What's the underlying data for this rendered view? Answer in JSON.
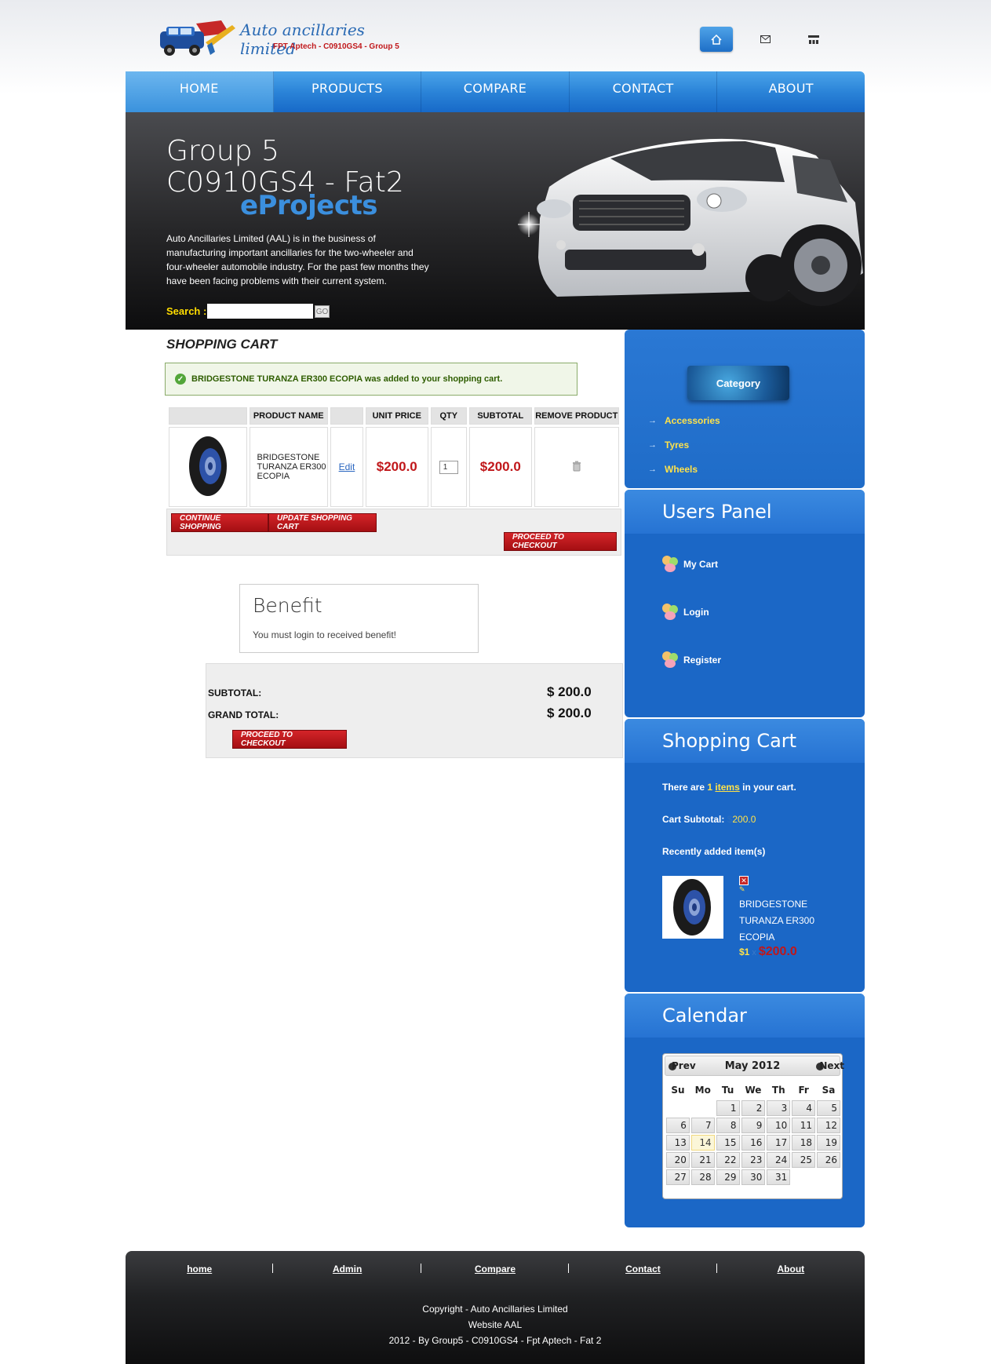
{
  "header": {
    "logo_title": "Auto ancillaries limited",
    "logo_subtitle": "FPT Aptech - C0910GS4 - Group 5",
    "icons": [
      "home-icon",
      "mail-icon",
      "sitemap-icon"
    ]
  },
  "nav": {
    "items": [
      "HOME",
      "PRODUCTS",
      "COMPARE",
      "CONTACT",
      "ABOUT"
    ],
    "active": "HOME"
  },
  "hero": {
    "title_line1": "Group 5",
    "title_line2": "C0910GS4 - Fat2",
    "eprojects": "eProjects",
    "description": "Auto Ancillaries Limited (AAL) is in the business of manufacturing important ancillaries for the two-wheeler and four-wheeler automobile industry. For the past few months they have been facing problems with their current system.",
    "search_label": "Search :",
    "search_value": "",
    "search_button": "GO"
  },
  "cart": {
    "title": "SHOPPING CART",
    "success_message": "BRIDGESTONE TURANZA ER300 ECOPIA was added to your shopping cart.",
    "columns": [
      "",
      "PRODUCT NAME",
      "",
      "UNIT PRICE",
      "QTY",
      "SUBTOTAL",
      "REMOVE PRODUCT"
    ],
    "rows": [
      {
        "name": "BRIDGESTONE TURANZA ER300 ECOPIA",
        "edit": "Edit",
        "unit_price": "$200.0",
        "qty": "1",
        "subtotal": "$200.0"
      }
    ],
    "continue_button": "CONTINUE SHOPPING",
    "update_button": "UPDATE SHOPPING CART",
    "checkout_button": "PROCEED TO CHECKOUT"
  },
  "benefit": {
    "title": "Benefit",
    "text": "You must login to received benefit!"
  },
  "totals": {
    "subtotal_label": "SUBTOTAL:",
    "subtotal_value": "$ 200.0",
    "grand_label": "GRAND TOTAL:",
    "grand_value": "$ 200.0",
    "checkout_button": "PROCEED TO CHECKOUT"
  },
  "sidebar": {
    "category": {
      "button": "Category",
      "items": [
        "Accessories",
        "Tyres",
        "Wheels"
      ]
    },
    "users_panel": {
      "title": "Users Panel",
      "items": [
        "My Cart",
        "Login",
        "Register"
      ]
    },
    "shopping_cart": {
      "title": "Shopping Cart",
      "there_are": "There are",
      "count": "1",
      "items_link": "items",
      "in_your_cart": "in your cart.",
      "subtotal_label": "Cart Subtotal:",
      "subtotal_currency": "$",
      "subtotal_value": "200.0",
      "recent_label": "Recently added item(s)",
      "recent_item_name": "BRIDGESTONE TURANZA ER300 ECOPIA",
      "recent_item_qty": "$1",
      "recent_item_x": "x",
      "recent_item_price": "$200.0"
    },
    "calendar": {
      "title": "Calendar",
      "month": "May 2012",
      "prev": "Prev",
      "next": "Next",
      "weekdays": [
        "Su",
        "Mo",
        "Tu",
        "We",
        "Th",
        "Fr",
        "Sa"
      ],
      "weeks": [
        [
          "",
          "",
          "1",
          "2",
          "3",
          "4",
          "5"
        ],
        [
          "6",
          "7",
          "8",
          "9",
          "10",
          "11",
          "12"
        ],
        [
          "13",
          "14",
          "15",
          "16",
          "17",
          "18",
          "19"
        ],
        [
          "20",
          "21",
          "22",
          "23",
          "24",
          "25",
          "26"
        ],
        [
          "27",
          "28",
          "29",
          "30",
          "31",
          "",
          ""
        ]
      ],
      "today": "14"
    }
  },
  "footer": {
    "links": [
      "home",
      "Admin",
      "Compare",
      "Contact",
      "About"
    ],
    "copyright": "Copyright - Auto Ancillaries Limited",
    "website": "Website AAL",
    "credit": "2012 - By Group5 - C0910GS4 - Fpt Aptech - Fat 2"
  },
  "colors": {
    "nav_blue": "#2b84d8",
    "sidebar_blue": "#1b67c6",
    "price_red": "#c0171a",
    "highlight_yellow": "#ffe24a"
  }
}
